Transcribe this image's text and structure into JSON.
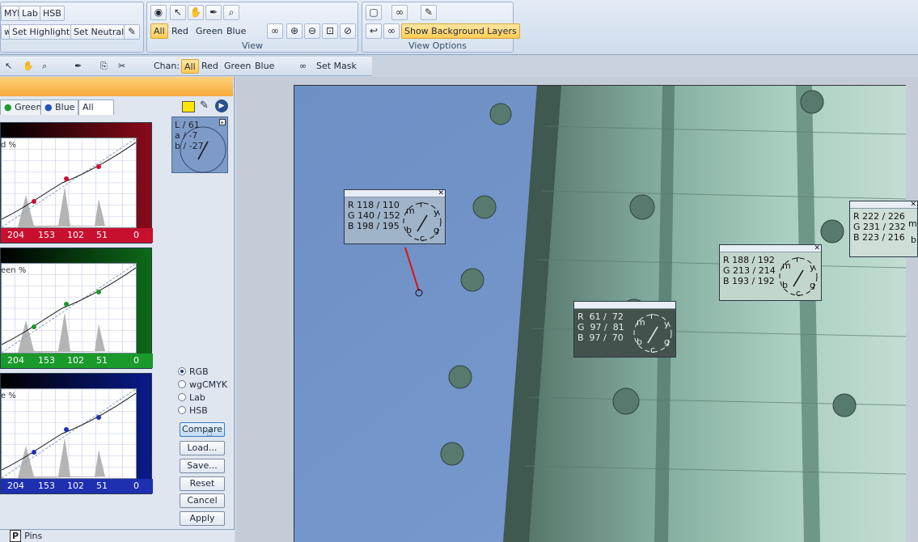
{
  "ribbon": {
    "mode_tabs": [
      "MYK",
      "Lab",
      "HSB"
    ],
    "highlight_row": [
      "w",
      "Set Highlight",
      "Set Neutral"
    ],
    "view_group": {
      "label": "View",
      "channels": [
        "All",
        "Red",
        "Green",
        "Blue"
      ],
      "selected_channel": "All"
    },
    "view_options": {
      "label": "View Options",
      "show_background_layers": "Show Background Layers"
    }
  },
  "toolbar2": {
    "chan_label": "Chan:",
    "channels": [
      "All",
      "Red",
      "Green",
      "Blue"
    ],
    "set_mask": "Set Mask"
  },
  "panel": {
    "tabs": [
      "Green",
      "Blue",
      "All"
    ],
    "selected_tab": "All",
    "curves": [
      {
        "label": "d %",
        "color": "#c8102e",
        "ticks": [
          "204",
          "153",
          "102",
          "51",
          "0"
        ]
      },
      {
        "label": "een %",
        "color": "#1a9a2a",
        "ticks": [
          "204",
          "153",
          "102",
          "51",
          "0"
        ]
      },
      {
        "label": "e %",
        "color": "#1e2fb0",
        "ticks": [
          "204",
          "153",
          "102",
          "51",
          "0"
        ]
      }
    ],
    "lab_readout": {
      "L": "L /   61",
      "a": "a /   -7",
      "b": "b /  -27"
    },
    "color_modes": [
      "RGB",
      "wgCMYK",
      "Lab",
      "HSB"
    ],
    "selected_mode": "RGB",
    "buttons": [
      "Compare",
      "Load...",
      "Save...",
      "Reset",
      "Cancel",
      "Apply"
    ]
  },
  "samplers": [
    {
      "r": "R 118 / 110",
      "g": "G 140 / 152",
      "b": "B 198 / 195"
    },
    {
      "r": "R  61 /  72",
      "g": "G  97 /  81",
      "b": "B  97 /  70"
    },
    {
      "r": "R 188 / 192",
      "g": "G 213 / 214",
      "b": "B 193 / 192"
    },
    {
      "r": "R 222 / 226",
      "g": "G 231 / 232",
      "b": "B 223 / 216"
    }
  ],
  "wheel_letters": [
    "m",
    "r",
    "y",
    "b",
    "c",
    "g"
  ],
  "pins": {
    "icon": "P",
    "label": "Pins"
  }
}
